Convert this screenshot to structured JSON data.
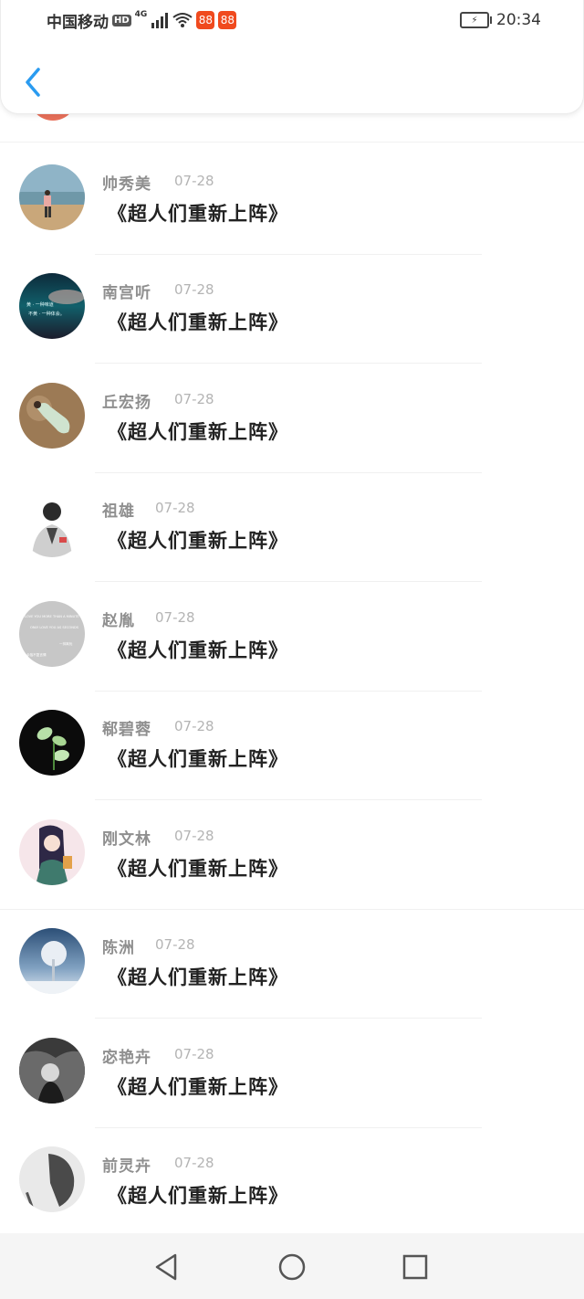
{
  "status_bar": {
    "carrier": "中国移动",
    "hd": "HD",
    "network": "4G",
    "time": "20:34",
    "app_badge": "88"
  },
  "header": {
    "back_icon": "chevron-left-icon",
    "accent_color": "#2a9bf0"
  },
  "items": [
    {
      "name": "帅秀美",
      "date": "07-28",
      "title": "《超人们重新上阵》"
    },
    {
      "name": "南宫听",
      "date": "07-28",
      "title": "《超人们重新上阵》"
    },
    {
      "name": "丘宏扬",
      "date": "07-28",
      "title": "《超人们重新上阵》"
    },
    {
      "name": "祖雄",
      "date": "07-28",
      "title": "《超人们重新上阵》"
    },
    {
      "name": "赵胤",
      "date": "07-28",
      "title": "《超人们重新上阵》"
    },
    {
      "name": "郗碧蓉",
      "date": "07-28",
      "title": "《超人们重新上阵》"
    },
    {
      "name": "刚文林",
      "date": "07-28",
      "title": "《超人们重新上阵》"
    },
    {
      "name": "陈洲",
      "date": "07-28",
      "title": "《超人们重新上阵》"
    },
    {
      "name": "宓艳卉",
      "date": "07-28",
      "title": "《超人们重新上阵》"
    },
    {
      "name": "前灵卉",
      "date": "07-28",
      "title": "《超人们重新上阵》"
    }
  ],
  "avatar_text": {
    "a1": "黄 · 一种味道",
    "a1b": "不黄 · 一种体会。",
    "a4a": "LOVE YOU MORE THAN A MINUTE",
    "a4b": "ONLY LOVE YOU AS SECONDS",
    "a4c": "一抹离忧",
    "a4d": "余独不复言情"
  },
  "nav": {
    "back": "triangle-back-icon",
    "home": "circle-home-icon",
    "recents": "square-recents-icon"
  }
}
